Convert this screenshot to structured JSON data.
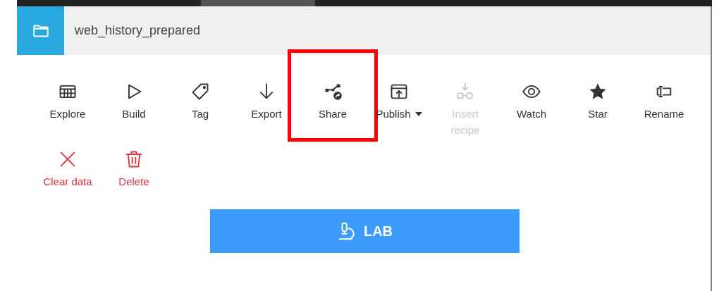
{
  "header": {
    "title": "web_history_prepared"
  },
  "actions": [
    {
      "label": "Explore",
      "kind": "normal",
      "disabled": false,
      "highlighted": false,
      "dropdown": false
    },
    {
      "label": "Build",
      "kind": "normal",
      "disabled": false,
      "highlighted": false,
      "dropdown": false
    },
    {
      "label": "Tag",
      "kind": "normal",
      "disabled": false,
      "highlighted": false,
      "dropdown": false
    },
    {
      "label": "Export",
      "kind": "normal",
      "disabled": false,
      "highlighted": false,
      "dropdown": false
    },
    {
      "label": "Share",
      "kind": "normal",
      "disabled": false,
      "highlighted": true,
      "dropdown": false
    },
    {
      "label": "Publish",
      "kind": "normal",
      "disabled": false,
      "highlighted": false,
      "dropdown": true
    },
    {
      "label": "Insert recipe",
      "kind": "normal",
      "disabled": true,
      "highlighted": false,
      "dropdown": false
    },
    {
      "label": "Watch",
      "kind": "normal",
      "disabled": false,
      "highlighted": false,
      "dropdown": false
    },
    {
      "label": "Star",
      "kind": "normal",
      "disabled": false,
      "highlighted": false,
      "dropdown": false
    },
    {
      "label": "Rename",
      "kind": "normal",
      "disabled": false,
      "highlighted": false,
      "dropdown": false
    },
    {
      "label": "Clear data",
      "kind": "danger",
      "disabled": false,
      "highlighted": false,
      "dropdown": false
    },
    {
      "label": "Delete",
      "kind": "danger",
      "disabled": false,
      "highlighted": false,
      "dropdown": false
    }
  ],
  "lab_button": {
    "label": "LAB"
  }
}
